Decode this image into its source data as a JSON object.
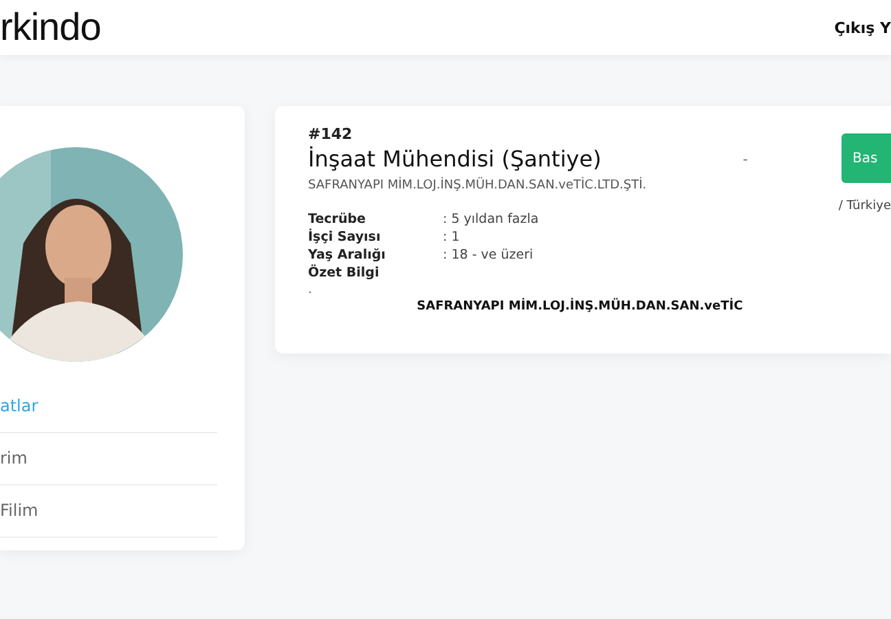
{
  "header": {
    "logo": "rkindo",
    "logout": "Çıkış Y"
  },
  "profile": {
    "menu": [
      {
        "label": "atlar",
        "selected": true
      },
      {
        "label": "rim",
        "selected": false
      },
      {
        "label": "Filim",
        "selected": false
      }
    ]
  },
  "job": {
    "id": "#142",
    "title": "İnşaat Mühendisi (Şantiye)",
    "company": "SAFRANYAPI MİM.LOJ.İNŞ.MÜH.DAN.SAN.veTİC.LTD.ŞTİ.",
    "dash": "-",
    "button": "Bas",
    "location": "/ Türkiye",
    "details": [
      {
        "label": "Tecrübe",
        "value": ": 5 yıldan fazla"
      },
      {
        "label": "İşçi Sayısı",
        "value": ": 1"
      },
      {
        "label": "Yaş Aralığı",
        "value": ": 18 - ve üzeri"
      },
      {
        "label": "Özet Bilgi"
      }
    ],
    "summary": ".",
    "footer": "SAFRANYAPI MİM.LOJ.İNŞ.MÜH.DAN.SAN.veTİC"
  }
}
